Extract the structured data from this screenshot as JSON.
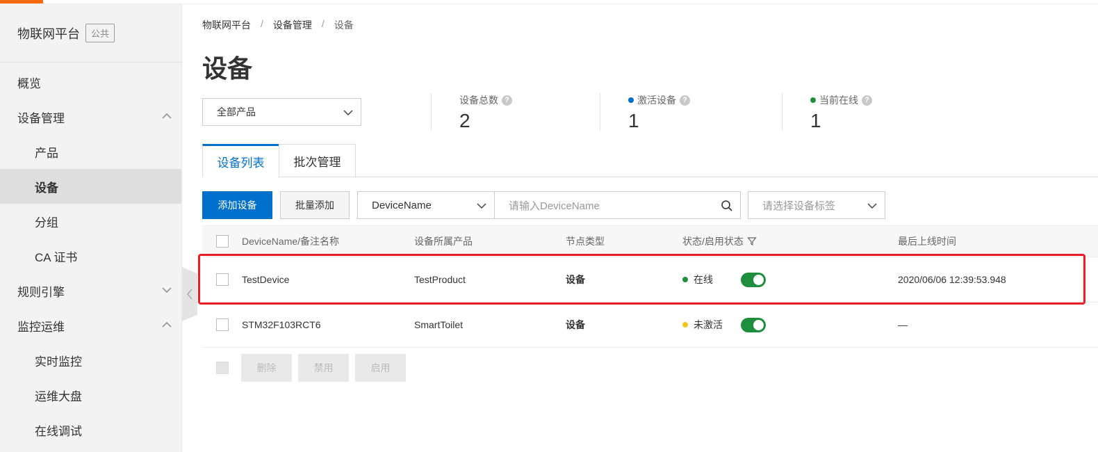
{
  "sidebar": {
    "title": "物联网平台",
    "badge": "公共",
    "items": [
      {
        "label": "概览"
      },
      {
        "label": "设备管理"
      },
      {
        "label": "产品"
      },
      {
        "label": "设备"
      },
      {
        "label": "分组"
      },
      {
        "label": "CA 证书"
      },
      {
        "label": "规则引擎"
      },
      {
        "label": "监控运维"
      },
      {
        "label": "实时监控"
      },
      {
        "label": "运维大盘"
      },
      {
        "label": "在线调试"
      }
    ]
  },
  "breadcrumb": [
    "物联网平台",
    "/",
    "设备管理",
    "/",
    "设备"
  ],
  "page_title": "设备",
  "product_select": {
    "value": "全部产品"
  },
  "stats": [
    {
      "label": "设备总数",
      "value": "2"
    },
    {
      "label": "激活设备",
      "value": "1",
      "dot_color": "#0070cc"
    },
    {
      "label": "当前在线",
      "value": "1",
      "dot_color": "#1e8e3e"
    }
  ],
  "tabs": [
    {
      "label": "设备列表"
    },
    {
      "label": "批次管理"
    }
  ],
  "toolbar": {
    "add_label": "添加设备",
    "batch_add_label": "批量添加",
    "field_select_value": "DeviceName",
    "search_placeholder": "请输入DeviceName",
    "tag_placeholder": "请选择设备标签"
  },
  "table": {
    "headers": [
      "DeviceName/备注名称",
      "设备所属产品",
      "节点类型",
      "状态/启用状态",
      "最后上线时间"
    ],
    "rows": [
      {
        "name": "TestDevice",
        "product": "TestProduct",
        "node_type": "设备",
        "status": "在线",
        "status_color": "#1e8e3e",
        "enabled": true,
        "last_online": "2020/06/06 12:39:53.948"
      },
      {
        "name": "STM32F103RCT6",
        "product": "SmartToilet",
        "node_type": "设备",
        "status": "未激活",
        "status_color": "#f5c518",
        "enabled": true,
        "last_online": "—"
      }
    ]
  },
  "footer_actions": {
    "delete_label": "删除",
    "disable_label": "禁用",
    "enable_label": "启用"
  },
  "colors": {
    "accent": "#0070cc",
    "brand": "#ff6a00",
    "online": "#1e8e3e",
    "inactive": "#f5c518",
    "highlight": "#ee1c25"
  }
}
